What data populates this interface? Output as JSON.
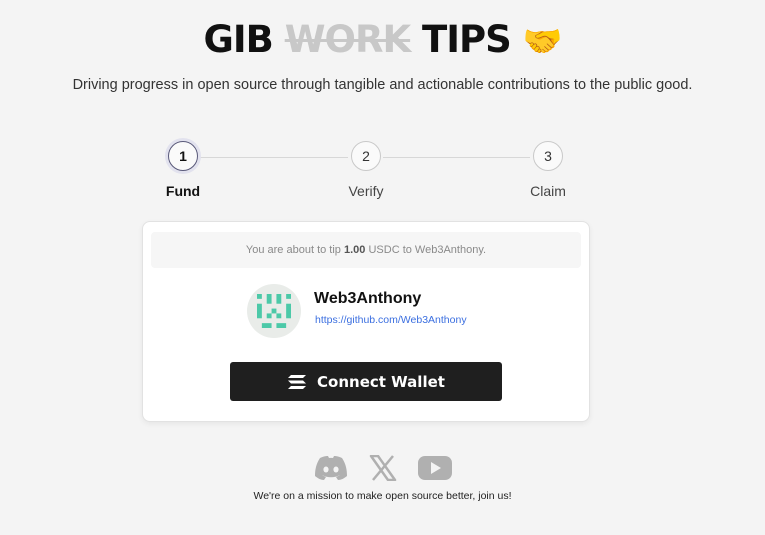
{
  "header": {
    "title_start": "GIB",
    "title_strike": "WORK",
    "title_end": "TIPS",
    "title_emoji": "🤝",
    "subtitle": "Driving progress in open source through tangible and actionable contributions to the public good."
  },
  "stepper": {
    "steps": [
      {
        "number": "1",
        "label": "Fund",
        "active": true
      },
      {
        "number": "2",
        "label": "Verify",
        "active": false
      },
      {
        "number": "3",
        "label": "Claim",
        "active": false
      }
    ]
  },
  "card": {
    "notice_prefix": "You are about to tip",
    "amount": "1.00",
    "notice_suffix": "USDC to Web3Anthony.",
    "recipient_name": "Web3Anthony",
    "recipient_url": "https://github.com/Web3Anthony",
    "connect_label": "Connect Wallet"
  },
  "footer": {
    "social_icons": [
      "discord-icon",
      "x-icon",
      "youtube-icon"
    ],
    "text": "We're on a mission to make open source better, join us!"
  },
  "colors": {
    "background": "#f4f4f4",
    "button": "#1f1f1f",
    "link": "#3b6fe0",
    "avatar_accent": "#4cc9a8",
    "icon_gray": "#b0b0b0"
  }
}
